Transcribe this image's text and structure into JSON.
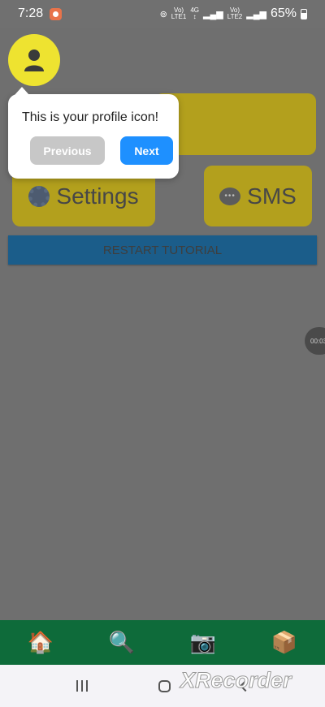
{
  "status_bar": {
    "time": "7:28",
    "network_1_top": "Vo)",
    "network_1_bottom": "LTE1",
    "network_gen": "4G",
    "network_2_top": "Vo)",
    "network_2_bottom": "LTE2",
    "battery": "65%"
  },
  "cards": {
    "settings_label": "Settings",
    "sms_label": "SMS"
  },
  "restart_button_label": "RESTART TUTORIAL",
  "timer_bubble": "00:03",
  "tooltip": {
    "text": "This is your profile icon!",
    "previous_label": "Previous",
    "next_label": "Next"
  },
  "tabbar": {
    "items": [
      {
        "icon": "home-icon",
        "glyph": "🏠"
      },
      {
        "icon": "search-icon",
        "glyph": "🔍"
      },
      {
        "icon": "camera-icon",
        "glyph": "📷"
      },
      {
        "icon": "package-icon",
        "glyph": "📦"
      }
    ]
  },
  "watermark": "XRecorder",
  "colors": {
    "overlay": "#6f6f6f",
    "card": "#b3a01d",
    "avatar": "#eee330",
    "next": "#1e90ff",
    "previous": "#c7c7c7",
    "tabbar": "#0e6b3a",
    "restart": "#1b5d8a"
  }
}
